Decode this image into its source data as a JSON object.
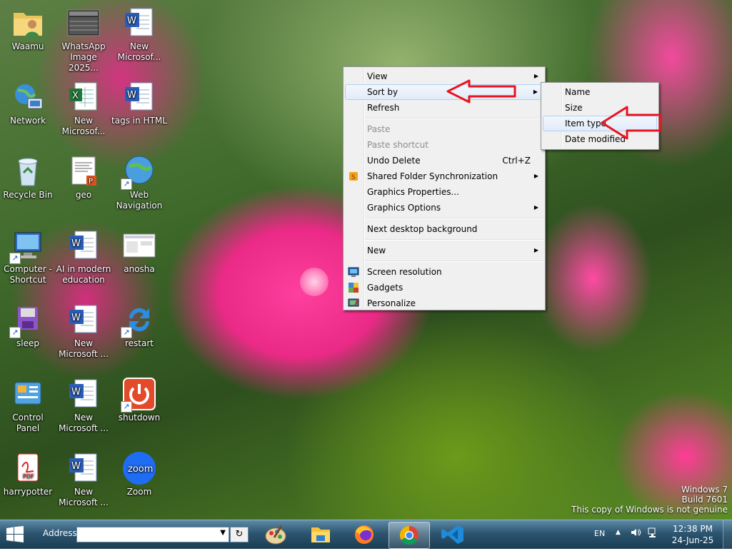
{
  "desktop": {
    "icons": [
      {
        "label": "Waamu",
        "icon": "folder-user-icon"
      },
      {
        "label": "WhatsApp Image 2025...",
        "icon": "image-file-icon"
      },
      {
        "label": "New Microsof...",
        "icon": "word-document-icon"
      },
      {
        "label": "Network",
        "icon": "network-icon"
      },
      {
        "label": "New Microsof...",
        "icon": "excel-document-icon"
      },
      {
        "label": "tags in HTML",
        "icon": "word-document-icon"
      },
      {
        "label": "Recycle Bin",
        "icon": "recycle-bin-icon"
      },
      {
        "label": "geo",
        "icon": "powerpoint-document-icon"
      },
      {
        "label": "Web Navigation",
        "icon": "globe-shortcut-icon"
      },
      {
        "label": "Computer - Shortcut",
        "icon": "computer-shortcut-icon"
      },
      {
        "label": "AI in modern education",
        "icon": "word-document-icon"
      },
      {
        "label": "anosha",
        "icon": "screenshot-image-icon"
      },
      {
        "label": "sleep",
        "icon": "sleep-shortcut-icon"
      },
      {
        "label": "New Microsoft ...",
        "icon": "word-document-icon"
      },
      {
        "label": "restart",
        "icon": "restart-shortcut-icon"
      },
      {
        "label": "Control Panel",
        "icon": "control-panel-icon"
      },
      {
        "label": "New Microsoft ...",
        "icon": "word-document-icon"
      },
      {
        "label": "shutdown",
        "icon": "shutdown-shortcut-icon"
      },
      {
        "label": "harrypotter",
        "icon": "pdf-document-icon"
      },
      {
        "label": "New Microsoft ...",
        "icon": "word-document-icon"
      },
      {
        "label": "Zoom",
        "icon": "zoom-app-icon"
      }
    ]
  },
  "context_menu": {
    "view": "View",
    "sort_by": "Sort by",
    "refresh": "Refresh",
    "paste": "Paste",
    "paste_shortcut": "Paste shortcut",
    "undo_delete": "Undo Delete",
    "undo_shortcut": "Ctrl+Z",
    "shared_folder_sync": "Shared Folder Synchronization",
    "graphics_properties": "Graphics Properties...",
    "graphics_options": "Graphics Options",
    "next_background": "Next desktop background",
    "new": "New",
    "screen_resolution": "Screen resolution",
    "gadgets": "Gadgets",
    "personalize": "Personalize"
  },
  "sort_submenu": {
    "name": "Name",
    "size": "Size",
    "item_type": "Item type",
    "date_modified": "Date modified"
  },
  "annotations": {
    "arrow_color": "#e8131e"
  },
  "taskbar": {
    "address_label": "Address",
    "address_value": "",
    "apps": [
      "paint-icon",
      "file-explorer-icon",
      "firefox-icon",
      "chrome-icon",
      "vscode-icon"
    ],
    "active_app": "chrome-icon"
  },
  "tray": {
    "language": "EN",
    "time": "12:38 PM",
    "date": "24-Jun-25"
  },
  "watermark": {
    "line1": "Windows 7",
    "line2": "Build 7601",
    "line3": "This copy of Windows is not genuine"
  }
}
